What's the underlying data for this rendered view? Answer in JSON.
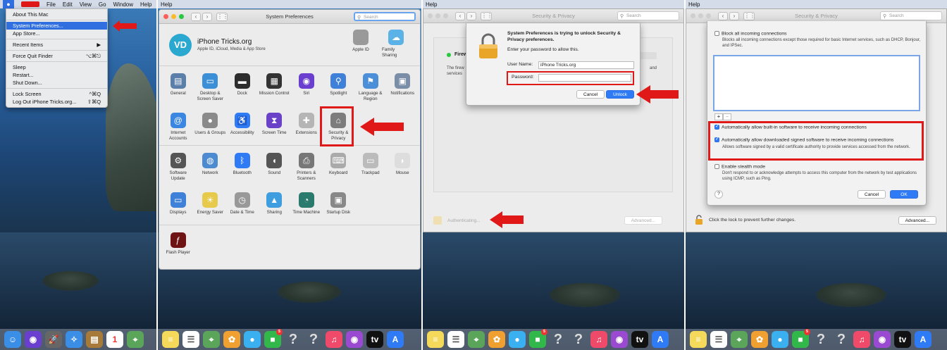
{
  "panel1": {
    "menubar": [
      "File",
      "Edit",
      "View",
      "Go",
      "Window",
      "Help"
    ],
    "apple_menu": [
      {
        "label": "About This Mac",
        "shortcut": ""
      },
      {
        "divider": true
      },
      {
        "label": "System Preferences...",
        "shortcut": "",
        "highlighted": true
      },
      {
        "label": "App Store...",
        "shortcut": ""
      },
      {
        "divider": true
      },
      {
        "label": "Recent Items",
        "shortcut": "▶"
      },
      {
        "divider": true
      },
      {
        "label": "Force Quit Finder",
        "shortcut": "⌥⌘⎋"
      },
      {
        "divider": true
      },
      {
        "label": "Sleep",
        "shortcut": ""
      },
      {
        "label": "Restart...",
        "shortcut": ""
      },
      {
        "label": "Shut Down...",
        "shortcut": ""
      },
      {
        "divider": true
      },
      {
        "label": "Lock Screen",
        "shortcut": "^⌘Q"
      },
      {
        "label": "Log Out iPhone Tricks.org...",
        "shortcut": "⇧⌘Q"
      }
    ]
  },
  "panel2": {
    "menubar_item": "Help",
    "title": "System Preferences",
    "search_placeholder": "Search",
    "account": {
      "initials": "VD",
      "name": "iPhone Tricks.org",
      "subtitle": "Apple ID, iCloud, Media & App Store"
    },
    "account_right": [
      {
        "label": "Apple ID",
        "icon": "apple-id-icon",
        "color": "#9a9a9a",
        "glyph": ""
      },
      {
        "label": "Family Sharing",
        "icon": "family-sharing-icon",
        "color": "#5ab2e6",
        "glyph": "☁"
      }
    ],
    "row1": [
      {
        "label": "General",
        "icon": "general-icon",
        "color": "#5b7fa8",
        "glyph": "▤"
      },
      {
        "label": "Desktop & Screen Saver",
        "icon": "desktop-icon",
        "color": "#3b8fd6",
        "glyph": "▭"
      },
      {
        "label": "Dock",
        "icon": "dock-icon",
        "color": "#2d2d2d",
        "glyph": "▬"
      },
      {
        "label": "Mission Control",
        "icon": "mission-control-icon",
        "color": "#333",
        "glyph": "▦"
      },
      {
        "label": "Siri",
        "icon": "siri-icon",
        "color": "#6a3fcf",
        "glyph": "◉"
      },
      {
        "label": "Spotlight",
        "icon": "spotlight-icon",
        "color": "#3f80d9",
        "glyph": "⚲"
      },
      {
        "label": "Language & Region",
        "icon": "language-icon",
        "color": "#4b8fd8",
        "glyph": "⚑"
      },
      {
        "label": "Notifications",
        "icon": "notifications-icon",
        "color": "#7a8ea8",
        "glyph": "▣"
      }
    ],
    "row2": [
      {
        "label": "Internet Accounts",
        "icon": "internet-accounts-icon",
        "color": "#3a86e0",
        "glyph": "@"
      },
      {
        "label": "Users & Groups",
        "icon": "users-icon",
        "color": "#8a8a8a",
        "glyph": "●"
      },
      {
        "label": "Accessibility",
        "icon": "accessibility-icon",
        "color": "#2f7bf5",
        "glyph": "♿"
      },
      {
        "label": "Screen Time",
        "icon": "screen-time-icon",
        "color": "#6a42c8",
        "glyph": "⧗"
      },
      {
        "label": "Extensions",
        "icon": "extensions-icon",
        "color": "#b5b5b5",
        "glyph": "✚"
      },
      {
        "label": "Security & Privacy",
        "icon": "security-icon",
        "color": "#7c7c7c",
        "glyph": "⌂"
      }
    ],
    "row3": [
      {
        "label": "Software Update",
        "icon": "software-update-icon",
        "color": "#555",
        "glyph": "⚙"
      },
      {
        "label": "Network",
        "icon": "network-icon",
        "color": "#4c8bd0",
        "glyph": "◍"
      },
      {
        "label": "Bluetooth",
        "icon": "bluetooth-icon",
        "color": "#2f7bf5",
        "glyph": "ᛒ"
      },
      {
        "label": "Sound",
        "icon": "sound-icon",
        "color": "#555",
        "glyph": "◖"
      },
      {
        "label": "Printers & Scanners",
        "icon": "printer-icon",
        "color": "#777",
        "glyph": "⎙"
      },
      {
        "label": "Keyboard",
        "icon": "keyboard-icon",
        "color": "#aaa",
        "glyph": "⌨"
      },
      {
        "label": "Trackpad",
        "icon": "trackpad-icon",
        "color": "#bbb",
        "glyph": "▭"
      },
      {
        "label": "Mouse",
        "icon": "mouse-icon",
        "color": "#ddd",
        "glyph": "◗"
      }
    ],
    "row4": [
      {
        "label": "Displays",
        "icon": "displays-icon",
        "color": "#3f80d9",
        "glyph": "▭"
      },
      {
        "label": "Energy Saver",
        "icon": "energy-saver-icon",
        "color": "#e7c94b",
        "glyph": "☀"
      },
      {
        "label": "Date & Time",
        "icon": "date-time-icon",
        "color": "#999",
        "glyph": "◷"
      },
      {
        "label": "Sharing",
        "icon": "sharing-icon",
        "color": "#3f9ee0",
        "glyph": "▲"
      },
      {
        "label": "Time Machine",
        "icon": "time-machine-icon",
        "color": "#2a7a6e",
        "glyph": "◔"
      },
      {
        "label": "Startup Disk",
        "icon": "startup-disk-icon",
        "color": "#888",
        "glyph": "▣"
      }
    ],
    "row5": [
      {
        "label": "Flash Player",
        "icon": "flash-player-icon",
        "color": "#6e1414",
        "glyph": "ƒ"
      }
    ]
  },
  "panel3": {
    "menubar_item": "Help",
    "title": "Security & Privacy",
    "search_placeholder": "Search",
    "bg_firewall": "Firew",
    "bg_text": "The firew",
    "bg_text2": "services",
    "bg_right": "and",
    "dialog": {
      "heading": "System Preferences is trying to unlock Security & Privacy preferences.",
      "sub": "Enter your password to allow this.",
      "user_label": "User Name:",
      "user_value": "iPhone Tricks.org",
      "password_label": "Password:",
      "password_value": "",
      "cancel": "Cancel",
      "unlock": "Unlock"
    },
    "authenticating": "Authenticating...",
    "advanced": "Advanced..."
  },
  "panel4": {
    "menubar_item": "Help",
    "title": "Security & Privacy",
    "search_placeholder": "Search",
    "block_all": "Block all incoming connections",
    "block_all_desc": "Blocks all incoming connections except those required for basic Internet services, such as DHCP, Bonjour, and IPSec.",
    "plus": "+",
    "minus": "−",
    "auto_builtin": "Automatically allow built-in software to receive incoming connections",
    "auto_signed": "Automatically allow downloaded signed software to receive incoming connections",
    "auto_signed_desc": "Allows software signed by a valid certificate authority to provide services accessed from the network.",
    "stealth": "Enable stealth mode",
    "stealth_desc": "Don't respond to or acknowledge attempts to access this computer from the network by test applications using ICMP, such as Ping.",
    "help": "?",
    "cancel": "Cancel",
    "ok": "OK",
    "lock_text": "Click the lock to prevent further changes.",
    "advanced": "Advanced..."
  },
  "dock": {
    "p1": [
      {
        "icon": "finder-icon",
        "color": "#3a8ee6",
        "glyph": "☺"
      },
      {
        "icon": "siri-dock-icon",
        "color": "#6a3fcf",
        "glyph": "◉"
      },
      {
        "icon": "launchpad-icon",
        "color": "#666",
        "glyph": "🚀"
      },
      {
        "icon": "safari-icon",
        "color": "#3a8ee6",
        "glyph": "✧"
      },
      {
        "icon": "notefile-icon",
        "color": "#a87a3a",
        "glyph": "▤"
      },
      {
        "icon": "calendar-icon",
        "color": "#fff",
        "glyph": "1",
        "text_color": "#e33"
      },
      {
        "icon": "maps-icon",
        "color": "#5aa55a",
        "glyph": "⌖"
      }
    ],
    "p2": [
      {
        "icon": "notes-icon",
        "color": "#f4d95a",
        "glyph": "≡"
      },
      {
        "icon": "reminders-icon",
        "color": "#fff",
        "glyph": "☰",
        "text_color": "#555"
      },
      {
        "icon": "maps-icon",
        "color": "#5aa55a",
        "glyph": "⌖"
      },
      {
        "icon": "photos-icon",
        "color": "#f0a030",
        "glyph": "✿"
      },
      {
        "icon": "messages-icon",
        "color": "#3ab0f0",
        "glyph": "●"
      },
      {
        "icon": "facetime-icon",
        "color": "#32b84a",
        "glyph": "■",
        "badge": "5"
      },
      {
        "icon": "question-icon",
        "color": "transparent",
        "glyph": "?",
        "text_color": "#ddd"
      },
      {
        "icon": "question-icon",
        "color": "transparent",
        "glyph": "?",
        "text_color": "#ddd"
      },
      {
        "icon": "music-icon",
        "color": "#f04a6a",
        "glyph": "♫"
      },
      {
        "icon": "podcasts-icon",
        "color": "#9a4ad0",
        "glyph": "◉"
      },
      {
        "icon": "tv-icon",
        "color": "#111",
        "glyph": "tv"
      },
      {
        "icon": "app-store-icon",
        "color": "#2f7bf5",
        "glyph": "A"
      }
    ],
    "p3": [
      {
        "icon": "notes-icon",
        "color": "#f4d95a",
        "glyph": "≡"
      },
      {
        "icon": "reminders-icon",
        "color": "#fff",
        "glyph": "☰",
        "text_color": "#555"
      },
      {
        "icon": "maps-icon",
        "color": "#5aa55a",
        "glyph": "⌖"
      },
      {
        "icon": "photos-icon",
        "color": "#f0a030",
        "glyph": "✿"
      },
      {
        "icon": "messages-icon",
        "color": "#3ab0f0",
        "glyph": "●"
      },
      {
        "icon": "facetime-icon",
        "color": "#32b84a",
        "glyph": "■",
        "badge": "5"
      },
      {
        "icon": "question-icon",
        "color": "transparent",
        "glyph": "?",
        "text_color": "#ddd"
      },
      {
        "icon": "question-icon",
        "color": "transparent",
        "glyph": "?",
        "text_color": "#ddd"
      },
      {
        "icon": "music-icon",
        "color": "#f04a6a",
        "glyph": "♫"
      },
      {
        "icon": "podcasts-icon",
        "color": "#9a4ad0",
        "glyph": "◉"
      },
      {
        "icon": "tv-icon",
        "color": "#111",
        "glyph": "tv"
      },
      {
        "icon": "app-store-icon",
        "color": "#2f7bf5",
        "glyph": "A"
      }
    ],
    "p4": [
      {
        "icon": "notes-icon",
        "color": "#f4d95a",
        "glyph": "≡"
      },
      {
        "icon": "reminders-icon",
        "color": "#fff",
        "glyph": "☰",
        "text_color": "#555"
      },
      {
        "icon": "maps-icon",
        "color": "#5aa55a",
        "glyph": "⌖"
      },
      {
        "icon": "photos-icon",
        "color": "#f0a030",
        "glyph": "✿"
      },
      {
        "icon": "messages-icon",
        "color": "#3ab0f0",
        "glyph": "●"
      },
      {
        "icon": "facetime-icon",
        "color": "#32b84a",
        "glyph": "■",
        "badge": "5"
      },
      {
        "icon": "question-icon",
        "color": "transparent",
        "glyph": "?",
        "text_color": "#ddd"
      },
      {
        "icon": "question-icon",
        "color": "transparent",
        "glyph": "?",
        "text_color": "#ddd"
      },
      {
        "icon": "music-icon",
        "color": "#f04a6a",
        "glyph": "♫"
      },
      {
        "icon": "podcasts-icon",
        "color": "#9a4ad0",
        "glyph": "◉"
      },
      {
        "icon": "tv-icon",
        "color": "#111",
        "glyph": "tv"
      },
      {
        "icon": "app-store-icon",
        "color": "#2f7bf5",
        "glyph": "A"
      }
    ]
  },
  "colors": {
    "highlight": "#e01818",
    "accent": "#2f7bf5"
  }
}
